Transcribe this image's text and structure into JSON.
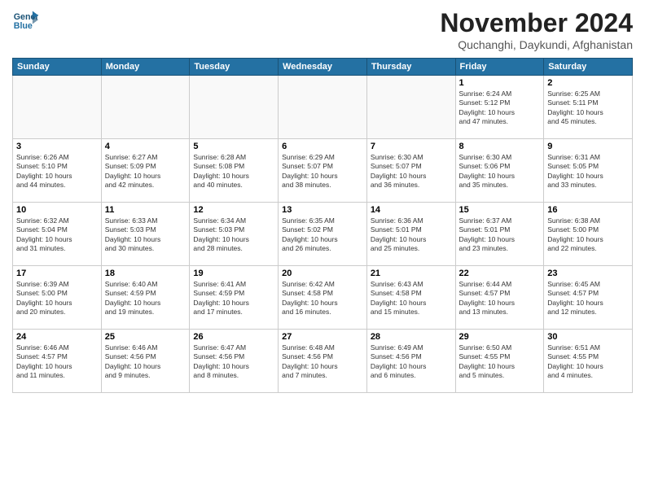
{
  "logo": {
    "line1": "General",
    "line2": "Blue"
  },
  "title": "November 2024",
  "subtitle": "Quchanghi, Daykundi, Afghanistan",
  "days_header": [
    "Sunday",
    "Monday",
    "Tuesday",
    "Wednesday",
    "Thursday",
    "Friday",
    "Saturday"
  ],
  "weeks": [
    [
      {
        "num": "",
        "info": ""
      },
      {
        "num": "",
        "info": ""
      },
      {
        "num": "",
        "info": ""
      },
      {
        "num": "",
        "info": ""
      },
      {
        "num": "",
        "info": ""
      },
      {
        "num": "1",
        "info": "Sunrise: 6:24 AM\nSunset: 5:12 PM\nDaylight: 10 hours\nand 47 minutes."
      },
      {
        "num": "2",
        "info": "Sunrise: 6:25 AM\nSunset: 5:11 PM\nDaylight: 10 hours\nand 45 minutes."
      }
    ],
    [
      {
        "num": "3",
        "info": "Sunrise: 6:26 AM\nSunset: 5:10 PM\nDaylight: 10 hours\nand 44 minutes."
      },
      {
        "num": "4",
        "info": "Sunrise: 6:27 AM\nSunset: 5:09 PM\nDaylight: 10 hours\nand 42 minutes."
      },
      {
        "num": "5",
        "info": "Sunrise: 6:28 AM\nSunset: 5:08 PM\nDaylight: 10 hours\nand 40 minutes."
      },
      {
        "num": "6",
        "info": "Sunrise: 6:29 AM\nSunset: 5:07 PM\nDaylight: 10 hours\nand 38 minutes."
      },
      {
        "num": "7",
        "info": "Sunrise: 6:30 AM\nSunset: 5:07 PM\nDaylight: 10 hours\nand 36 minutes."
      },
      {
        "num": "8",
        "info": "Sunrise: 6:30 AM\nSunset: 5:06 PM\nDaylight: 10 hours\nand 35 minutes."
      },
      {
        "num": "9",
        "info": "Sunrise: 6:31 AM\nSunset: 5:05 PM\nDaylight: 10 hours\nand 33 minutes."
      }
    ],
    [
      {
        "num": "10",
        "info": "Sunrise: 6:32 AM\nSunset: 5:04 PM\nDaylight: 10 hours\nand 31 minutes."
      },
      {
        "num": "11",
        "info": "Sunrise: 6:33 AM\nSunset: 5:03 PM\nDaylight: 10 hours\nand 30 minutes."
      },
      {
        "num": "12",
        "info": "Sunrise: 6:34 AM\nSunset: 5:03 PM\nDaylight: 10 hours\nand 28 minutes."
      },
      {
        "num": "13",
        "info": "Sunrise: 6:35 AM\nSunset: 5:02 PM\nDaylight: 10 hours\nand 26 minutes."
      },
      {
        "num": "14",
        "info": "Sunrise: 6:36 AM\nSunset: 5:01 PM\nDaylight: 10 hours\nand 25 minutes."
      },
      {
        "num": "15",
        "info": "Sunrise: 6:37 AM\nSunset: 5:01 PM\nDaylight: 10 hours\nand 23 minutes."
      },
      {
        "num": "16",
        "info": "Sunrise: 6:38 AM\nSunset: 5:00 PM\nDaylight: 10 hours\nand 22 minutes."
      }
    ],
    [
      {
        "num": "17",
        "info": "Sunrise: 6:39 AM\nSunset: 5:00 PM\nDaylight: 10 hours\nand 20 minutes."
      },
      {
        "num": "18",
        "info": "Sunrise: 6:40 AM\nSunset: 4:59 PM\nDaylight: 10 hours\nand 19 minutes."
      },
      {
        "num": "19",
        "info": "Sunrise: 6:41 AM\nSunset: 4:59 PM\nDaylight: 10 hours\nand 17 minutes."
      },
      {
        "num": "20",
        "info": "Sunrise: 6:42 AM\nSunset: 4:58 PM\nDaylight: 10 hours\nand 16 minutes."
      },
      {
        "num": "21",
        "info": "Sunrise: 6:43 AM\nSunset: 4:58 PM\nDaylight: 10 hours\nand 15 minutes."
      },
      {
        "num": "22",
        "info": "Sunrise: 6:44 AM\nSunset: 4:57 PM\nDaylight: 10 hours\nand 13 minutes."
      },
      {
        "num": "23",
        "info": "Sunrise: 6:45 AM\nSunset: 4:57 PM\nDaylight: 10 hours\nand 12 minutes."
      }
    ],
    [
      {
        "num": "24",
        "info": "Sunrise: 6:46 AM\nSunset: 4:57 PM\nDaylight: 10 hours\nand 11 minutes."
      },
      {
        "num": "25",
        "info": "Sunrise: 6:46 AM\nSunset: 4:56 PM\nDaylight: 10 hours\nand 9 minutes."
      },
      {
        "num": "26",
        "info": "Sunrise: 6:47 AM\nSunset: 4:56 PM\nDaylight: 10 hours\nand 8 minutes."
      },
      {
        "num": "27",
        "info": "Sunrise: 6:48 AM\nSunset: 4:56 PM\nDaylight: 10 hours\nand 7 minutes."
      },
      {
        "num": "28",
        "info": "Sunrise: 6:49 AM\nSunset: 4:56 PM\nDaylight: 10 hours\nand 6 minutes."
      },
      {
        "num": "29",
        "info": "Sunrise: 6:50 AM\nSunset: 4:55 PM\nDaylight: 10 hours\nand 5 minutes."
      },
      {
        "num": "30",
        "info": "Sunrise: 6:51 AM\nSunset: 4:55 PM\nDaylight: 10 hours\nand 4 minutes."
      }
    ]
  ]
}
